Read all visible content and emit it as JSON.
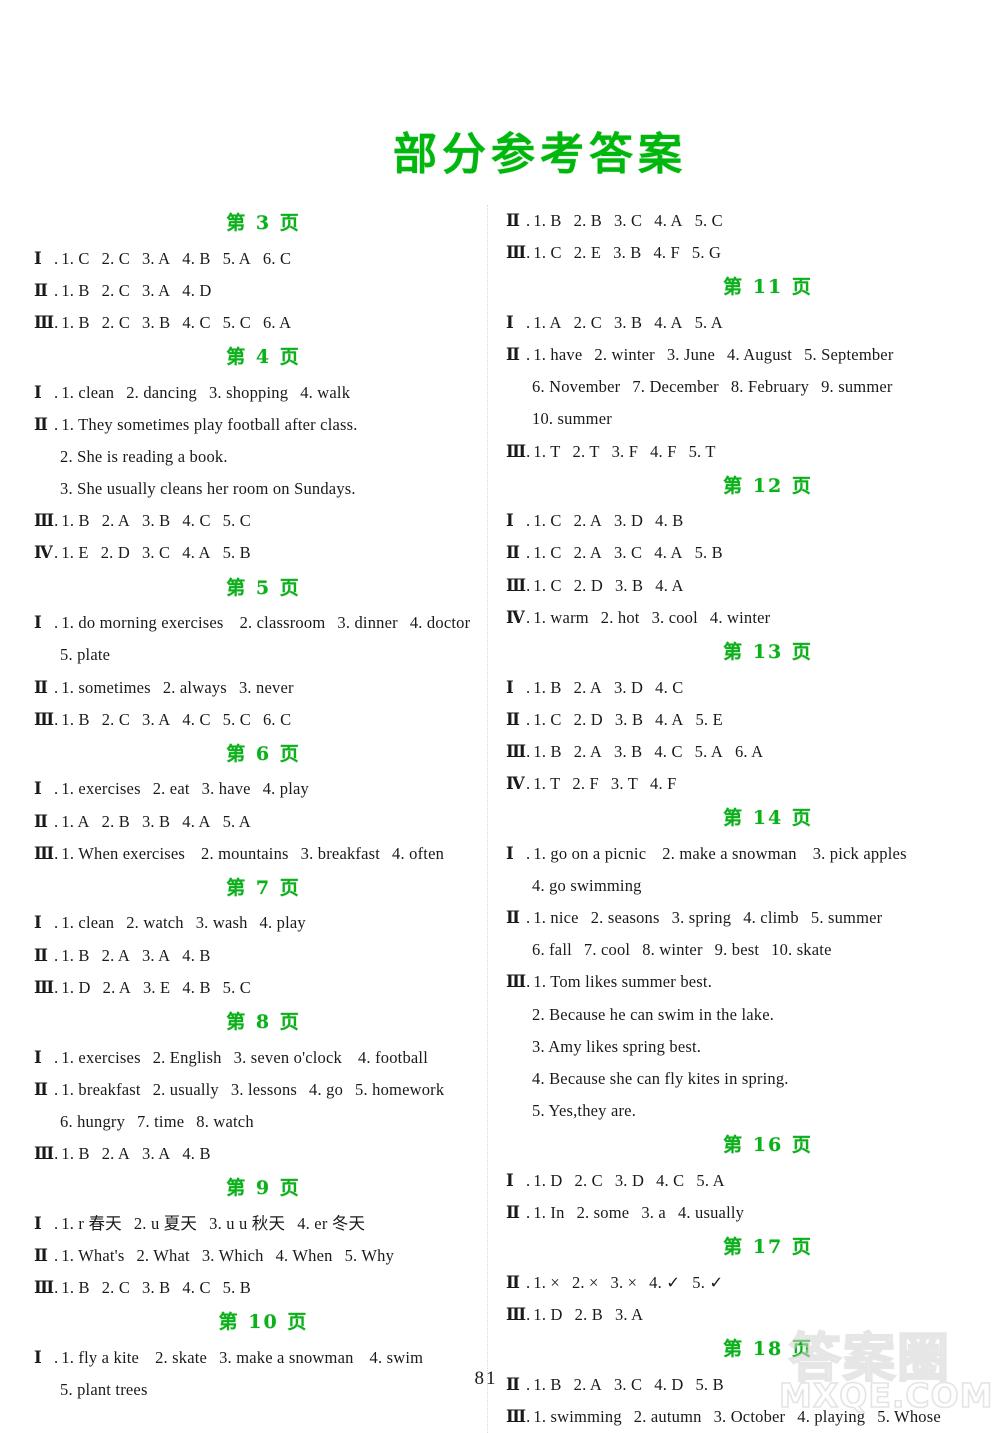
{
  "document": {
    "title": "部分参考答案",
    "folio": "81",
    "title_color": "#00b80d",
    "heading_color": "#0bb11a"
  },
  "watermark": {
    "cjk": "答案圈",
    "domain": "MXQE.COM"
  },
  "left_column": [
    {
      "type": "page_head",
      "text": "第 3 页"
    },
    {
      "type": "answers",
      "roman": "Ⅰ",
      "items": [
        "1. C",
        "2. C",
        "3. A",
        "4. B",
        "5. A",
        "6. C"
      ]
    },
    {
      "type": "answers",
      "roman": "Ⅱ",
      "items": [
        "1. B",
        "2. C",
        "3. A",
        "4. D"
      ]
    },
    {
      "type": "answers",
      "roman": "Ⅲ",
      "items": [
        "1. B",
        "2. C",
        "3. B",
        "4. C",
        "5. C",
        "6. A"
      ]
    },
    {
      "type": "page_head",
      "text": "第 4 页"
    },
    {
      "type": "answers",
      "roman": "Ⅰ",
      "items": [
        "1. clean",
        "2. dancing",
        "3. shopping",
        "4. walk"
      ]
    },
    {
      "type": "answers",
      "roman": "Ⅱ",
      "items": [
        "1. They sometimes play football after class."
      ]
    },
    {
      "type": "cont",
      "items": [
        "2. She is reading a book."
      ]
    },
    {
      "type": "cont",
      "items": [
        "3. She usually cleans her room on Sundays."
      ]
    },
    {
      "type": "answers",
      "roman": "Ⅲ",
      "items": [
        "1. B",
        "2. A",
        "3. B",
        "4. C",
        "5. C"
      ]
    },
    {
      "type": "answers",
      "roman": "Ⅳ",
      "items": [
        "1. E",
        "2. D",
        "3. C",
        "4. A",
        "5. B"
      ]
    },
    {
      "type": "page_head",
      "text": "第 5 页"
    },
    {
      "type": "answers",
      "roman": "Ⅰ",
      "items": [
        "1. do morning exercises",
        "2. classroom",
        "3. dinner",
        "4. doctor"
      ]
    },
    {
      "type": "cont",
      "items": [
        "5. plate"
      ]
    },
    {
      "type": "answers",
      "roman": "Ⅱ",
      "items": [
        "1. sometimes",
        "2. always",
        "3. never"
      ]
    },
    {
      "type": "answers",
      "roman": "Ⅲ",
      "items": [
        "1. B",
        "2. C",
        "3. A",
        "4. C",
        "5. C",
        "6. C"
      ]
    },
    {
      "type": "page_head",
      "text": "第 6 页"
    },
    {
      "type": "answers",
      "roman": "Ⅰ",
      "items": [
        "1. exercises",
        "2. eat",
        "3. have",
        "4. play"
      ]
    },
    {
      "type": "answers",
      "roman": "Ⅱ",
      "items": [
        "1. A",
        "2. B",
        "3. B",
        "4. A",
        "5. A"
      ]
    },
    {
      "type": "answers",
      "roman": "Ⅲ",
      "items": [
        "1. When   exercises",
        "2. mountains",
        "3. breakfast",
        "4. often"
      ]
    },
    {
      "type": "page_head",
      "text": "第 7 页"
    },
    {
      "type": "answers",
      "roman": "Ⅰ",
      "items": [
        "1. clean",
        "2. watch",
        "3. wash",
        "4. play"
      ]
    },
    {
      "type": "answers",
      "roman": "Ⅱ",
      "items": [
        "1. B",
        "2. A",
        "3. A",
        "4. B"
      ]
    },
    {
      "type": "answers",
      "roman": "Ⅲ",
      "items": [
        "1. D",
        "2. A",
        "3. E",
        "4. B",
        "5. C"
      ]
    },
    {
      "type": "page_head",
      "text": "第 8 页"
    },
    {
      "type": "answers",
      "roman": "Ⅰ",
      "items": [
        "1. exercises",
        "2. English",
        "3. seven o'clock",
        "4. football"
      ]
    },
    {
      "type": "answers",
      "roman": "Ⅱ",
      "items": [
        "1. breakfast",
        "2. usually",
        "3. lessons",
        "4. go",
        "5. homework"
      ]
    },
    {
      "type": "cont",
      "items": [
        "6. hungry",
        "7. time",
        "8. watch"
      ]
    },
    {
      "type": "answers",
      "roman": "Ⅲ",
      "items": [
        "1. B",
        "2. A",
        "3. A",
        "4. B"
      ]
    },
    {
      "type": "page_head",
      "text": "第 9 页"
    },
    {
      "type": "answers",
      "roman": "Ⅰ",
      "items": [
        "1. r   春天",
        "2. u   夏天",
        "3. u u   秋天",
        "4. er   冬天"
      ]
    },
    {
      "type": "answers",
      "roman": "Ⅱ",
      "items": [
        "1. What's",
        "2. What",
        "3. Which",
        "4. When",
        "5. Why"
      ]
    },
    {
      "type": "answers",
      "roman": "Ⅲ",
      "items": [
        "1. B",
        "2. C",
        "3. B",
        "4. C",
        "5. B"
      ]
    },
    {
      "type": "page_head",
      "text": "第 10 页"
    },
    {
      "type": "answers",
      "roman": "Ⅰ",
      "items": [
        "1. fly a kite",
        "2. skate",
        "3. make a snowman",
        "4. swim"
      ]
    },
    {
      "type": "cont",
      "items": [
        "5. plant trees"
      ]
    }
  ],
  "right_column": [
    {
      "type": "answers",
      "roman": "Ⅱ",
      "items": [
        "1. B",
        "2. B",
        "3. C",
        "4. A",
        "5. C"
      ]
    },
    {
      "type": "answers",
      "roman": "Ⅲ",
      "items": [
        "1. C",
        "2. E",
        "3. B",
        "4. F",
        "5. G"
      ]
    },
    {
      "type": "page_head",
      "text": "第 11 页"
    },
    {
      "type": "answers",
      "roman": "Ⅰ",
      "items": [
        "1. A",
        "2. C",
        "3. B",
        "4. A",
        "5. A"
      ]
    },
    {
      "type": "answers",
      "roman": "Ⅱ",
      "items": [
        "1. have",
        "2. winter",
        "3. June",
        "4. August",
        "5. September"
      ]
    },
    {
      "type": "cont",
      "items": [
        "6. November",
        "7. December",
        "8. February",
        "9. summer"
      ]
    },
    {
      "type": "cont",
      "items": [
        "10. summer"
      ]
    },
    {
      "type": "answers",
      "roman": "Ⅲ",
      "items": [
        "1. T",
        "2. T",
        "3. F",
        "4. F",
        "5. T"
      ]
    },
    {
      "type": "page_head",
      "text": "第 12 页"
    },
    {
      "type": "answers",
      "roman": "Ⅰ",
      "items": [
        "1. C",
        "2. A",
        "3. D",
        "4. B"
      ]
    },
    {
      "type": "answers",
      "roman": "Ⅱ",
      "items": [
        "1. C",
        "2. A",
        "3. C",
        "4. A",
        "5. B"
      ]
    },
    {
      "type": "answers",
      "roman": "Ⅲ",
      "items": [
        "1. C",
        "2. D",
        "3. B",
        "4. A"
      ]
    },
    {
      "type": "answers",
      "roman": "Ⅳ",
      "items": [
        "1. warm",
        "2. hot",
        "3. cool",
        "4. winter"
      ]
    },
    {
      "type": "page_head",
      "text": "第 13 页"
    },
    {
      "type": "answers",
      "roman": "Ⅰ",
      "items": [
        "1. B",
        "2. A",
        "3. D",
        "4. C"
      ]
    },
    {
      "type": "answers",
      "roman": "Ⅱ",
      "items": [
        "1. C",
        "2. D",
        "3. B",
        "4. A",
        "5. E"
      ]
    },
    {
      "type": "answers",
      "roman": "Ⅲ",
      "items": [
        "1. B",
        "2. A",
        "3. B",
        "4. C",
        "5. A",
        "6. A"
      ]
    },
    {
      "type": "answers",
      "roman": "Ⅳ",
      "items": [
        "1. T",
        "2. F",
        "3. T",
        "4. F"
      ]
    },
    {
      "type": "page_head",
      "text": "第 14 页"
    },
    {
      "type": "answers",
      "roman": "Ⅰ",
      "items": [
        "1. go on a picnic",
        "2. make a snowman",
        "3. pick apples"
      ]
    },
    {
      "type": "cont",
      "items": [
        "4. go swimming"
      ]
    },
    {
      "type": "answers",
      "roman": "Ⅱ",
      "items": [
        "1. nice",
        "2. seasons",
        "3. spring",
        "4. climb",
        "5. summer"
      ]
    },
    {
      "type": "cont",
      "items": [
        "6. fall",
        "7. cool",
        "8. winter",
        "9. best",
        "10. skate"
      ]
    },
    {
      "type": "answers",
      "roman": "Ⅲ",
      "items": [
        "1. Tom likes summer best."
      ]
    },
    {
      "type": "cont",
      "items": [
        "2. Because he can swim in the lake."
      ]
    },
    {
      "type": "cont",
      "items": [
        "3. Amy likes spring best."
      ]
    },
    {
      "type": "cont",
      "items": [
        "4. Because she can fly kites in spring."
      ]
    },
    {
      "type": "cont",
      "items": [
        "5. Yes,they are."
      ]
    },
    {
      "type": "page_head",
      "text": "第 16 页"
    },
    {
      "type": "answers",
      "roman": "Ⅰ",
      "items": [
        "1. D",
        "2. C",
        "3. D",
        "4. C",
        "5. A"
      ]
    },
    {
      "type": "answers",
      "roman": "Ⅱ",
      "items": [
        "1. In",
        "2. some",
        "3. a",
        "4. usually"
      ]
    },
    {
      "type": "page_head",
      "text": "第 17 页"
    },
    {
      "type": "answers",
      "roman": "Ⅱ",
      "items": [
        "1. ×",
        "2. ×",
        "3. ×",
        "4. ✓",
        "5. ✓"
      ]
    },
    {
      "type": "answers",
      "roman": "Ⅲ",
      "items": [
        "1. D",
        "2. B",
        "3. A"
      ]
    },
    {
      "type": "page_head",
      "text": "第 18 页"
    },
    {
      "type": "answers",
      "roman": "Ⅱ",
      "items": [
        "1. B",
        "2. A",
        "3. C",
        "4. D",
        "5. B"
      ]
    },
    {
      "type": "answers",
      "roman": "Ⅲ",
      "items": [
        "1. swimming",
        "2. autumn",
        "3. October",
        "4. playing",
        "5. Whose"
      ]
    }
  ]
}
